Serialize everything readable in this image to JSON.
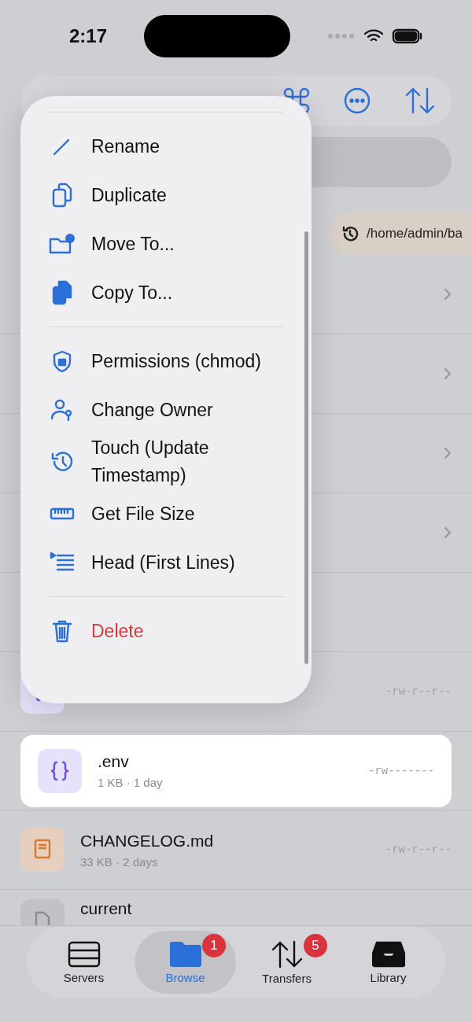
{
  "status_bar": {
    "time": "2:17"
  },
  "path_chips": [
    {
      "label": "/home/admin/ba"
    }
  ],
  "rows": [
    {
      "kind": "folder"
    },
    {
      "kind": "folder"
    },
    {
      "kind": "folder"
    },
    {
      "kind": "folder"
    },
    {
      "kind": "empty"
    },
    {
      "kind": "code",
      "permissions": "-rw-r--r--",
      "selected": false
    },
    {
      "kind": "code",
      "name": ".env",
      "meta": "1 KB · 1 day",
      "permissions": "-rw-------",
      "selected": true
    },
    {
      "kind": "book",
      "name": "CHANGELOG.md",
      "meta": "33 KB · 2 days",
      "permissions": "-rw-r--r--",
      "selected": false
    },
    {
      "kind": "doc",
      "name": "current",
      "selected": false
    }
  ],
  "menu": {
    "groups": [
      [
        {
          "label": "Rename",
          "kind": "action"
        },
        {
          "label": "Duplicate",
          "kind": "action"
        },
        {
          "label": "Move To...",
          "kind": "action"
        },
        {
          "label": "Copy To...",
          "kind": "action"
        }
      ],
      [
        {
          "label": "Permissions (chmod)",
          "kind": "action"
        },
        {
          "label": "Change Owner",
          "kind": "action"
        },
        {
          "label": "Touch (Update Timestamp)",
          "kind": "action"
        },
        {
          "label": "Get File Size",
          "kind": "action"
        },
        {
          "label": "Head (First Lines)",
          "kind": "action"
        }
      ],
      [
        {
          "label": "Delete",
          "kind": "destructive"
        }
      ]
    ]
  },
  "tabs": [
    {
      "label": "Servers",
      "selected": false
    },
    {
      "label": "Browse",
      "selected": true,
      "badge": "1"
    },
    {
      "label": "Transfers",
      "selected": false,
      "badge": "5"
    },
    {
      "label": "Library",
      "selected": false
    }
  ]
}
